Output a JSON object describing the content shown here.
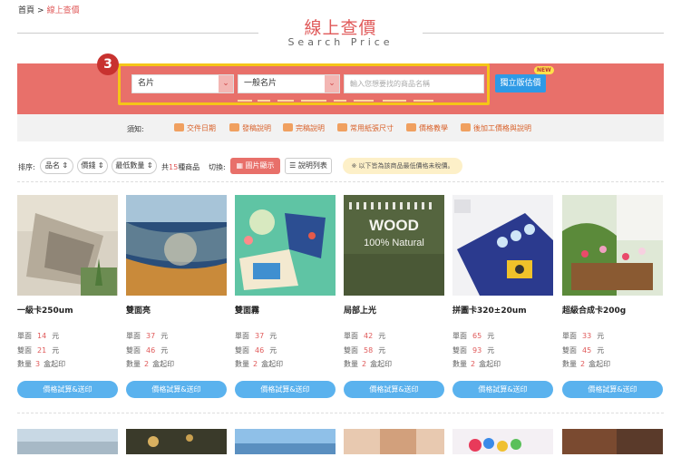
{
  "breadcrumb": {
    "home": "首頁",
    "separator": ">",
    "current": "線上查價"
  },
  "page_title": {
    "cn": "線上查價",
    "en": "Search Price"
  },
  "step_badge": "3",
  "search": {
    "category_value": "名片",
    "subcategory_value": "一般名片",
    "keyword_placeholder": "輸入您想要找的商品名稱",
    "estimate_button": "獨立版估價",
    "new_tag": "NEW"
  },
  "notice": {
    "label": "須知:",
    "links": [
      "交件日期",
      "發稿說明",
      "完稿說明",
      "常用紙張尺寸",
      "價格教學",
      "後加工價格與說明"
    ]
  },
  "sort": {
    "label": "排序:",
    "chips": [
      "品名",
      "價錢",
      "最低數量"
    ],
    "total_prefix": "共",
    "total_count": "15",
    "total_suffix": "種商品",
    "view_label": "切換:",
    "view_grid": "圖片顯示",
    "view_list": "說明列表",
    "tax_note": "※ 以下皆為該商品最低價格未稅價。"
  },
  "labels": {
    "single": "單面",
    "double": "雙面",
    "qty": "數量",
    "unit": "元",
    "qty_unit": "盒起印",
    "button": "價格試算&送印"
  },
  "products": [
    {
      "name": "一級卡250um",
      "single": "14",
      "double": "21",
      "qty": "3"
    },
    {
      "name": "雙面亮",
      "single": "37",
      "double": "46",
      "qty": "2"
    },
    {
      "name": "雙面霧",
      "single": "37",
      "double": "46",
      "qty": "2"
    },
    {
      "name": "局部上光",
      "single": "42",
      "double": "58",
      "qty": "2"
    },
    {
      "name": "拼圖卡320±20um",
      "single": "65",
      "double": "93",
      "qty": "2"
    },
    {
      "name": "超級合成卡200g",
      "single": "33",
      "double": "45",
      "qty": "2"
    }
  ],
  "wood_text": {
    "line1": "WOOD",
    "line2": "100% Natural"
  },
  "colors": {
    "accent": "#e05a5a",
    "band": "#e8706a",
    "highlight": "#f5c518",
    "button": "#5ab2ee",
    "badge": "#c8322f"
  }
}
